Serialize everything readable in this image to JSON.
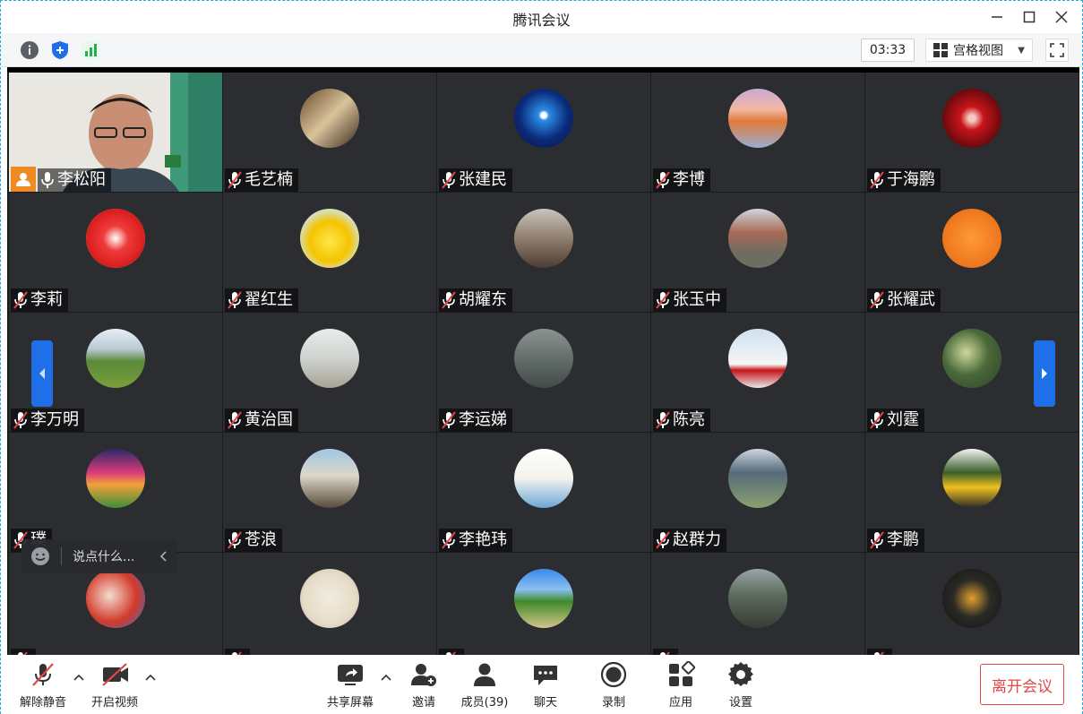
{
  "window": {
    "title": "腾讯会议"
  },
  "toolbar": {
    "timer": "03:33",
    "view_label": "宫格视图"
  },
  "colors": {
    "accent": "#1f6fe8",
    "danger": "#e04848",
    "active_border": "#3bd46d",
    "tile_bg": "#2b2d31"
  },
  "participants": [
    {
      "name": "李松阳",
      "mic": "on",
      "video": true
    },
    {
      "name": "毛艺楠",
      "mic": "muted"
    },
    {
      "name": "张建民",
      "mic": "muted"
    },
    {
      "name": "李博",
      "mic": "muted"
    },
    {
      "name": "于海鹏",
      "mic": "muted"
    },
    {
      "name": "李莉",
      "mic": "muted"
    },
    {
      "name": "翟红生",
      "mic": "muted"
    },
    {
      "name": "胡耀东",
      "mic": "muted"
    },
    {
      "name": "张玉中",
      "mic": "muted"
    },
    {
      "name": "张耀武",
      "mic": "muted"
    },
    {
      "name": "李万明",
      "mic": "muted"
    },
    {
      "name": "黄治国",
      "mic": "muted"
    },
    {
      "name": "李运娣",
      "mic": "muted"
    },
    {
      "name": "陈亮",
      "mic": "muted"
    },
    {
      "name": "刘霆",
      "mic": "muted"
    },
    {
      "name": "璞",
      "mic": "muted"
    },
    {
      "name": "苍浪",
      "mic": "muted"
    },
    {
      "name": "李艳玮",
      "mic": "muted"
    },
    {
      "name": "赵群力",
      "mic": "muted"
    },
    {
      "name": "李鹏",
      "mic": "muted"
    },
    {
      "name": "",
      "mic": "muted"
    },
    {
      "name": "",
      "mic": "muted"
    },
    {
      "name": "",
      "mic": "muted"
    },
    {
      "name": "",
      "mic": "muted"
    },
    {
      "name": "",
      "mic": "muted"
    }
  ],
  "chat": {
    "placeholder": "说点什么..."
  },
  "bottombar": {
    "unmute": "解除静音",
    "start_video": "开启视频",
    "share_screen": "共享屏幕",
    "invite": "邀请",
    "members": "成员(39)",
    "chat": "聊天",
    "record": "录制",
    "apps": "应用",
    "settings": "设置",
    "leave": "离开会议"
  }
}
